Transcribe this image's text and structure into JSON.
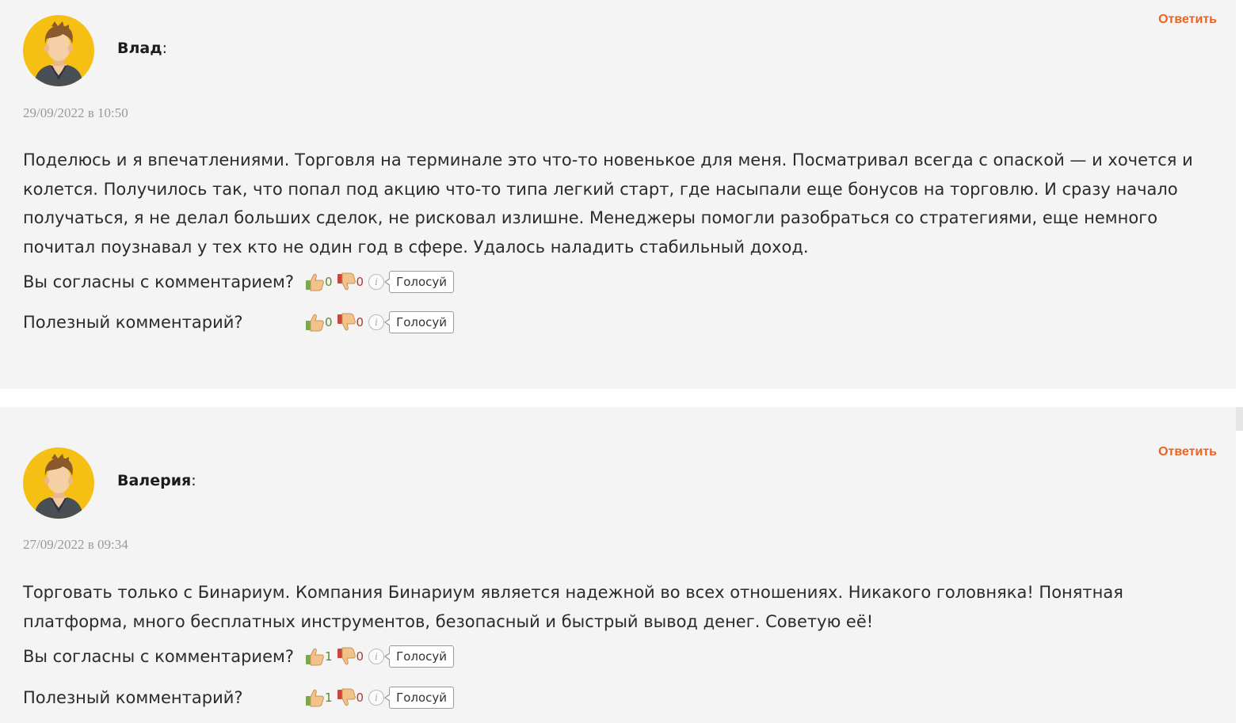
{
  "comments": [
    {
      "author": "Влад",
      "reply_label": "Ответить",
      "date": "29/09/2022 в 10:50",
      "text": "Поделюсь и я впечатлениями. Торговля на терминале это что-то новенькое для меня. Посматривал всегда с опаской — и хочется и колется. Получилось так, что попал под акцию что-то типа легкий старт, где насыпали еще бонусов на торговлю. И сразу начало получаться, я не делал больших сделок, не рисковал излишне. Менеджеры помогли разобраться со стратегиями, еще немного почитал поузнавал у тех кто не один год в сфере. Удалось наладить стабильный доход.",
      "agree": {
        "question": "Вы согласны с комментарием?",
        "up": "0",
        "down": "0",
        "button": "Голосуй"
      },
      "useful": {
        "question": "Полезный комментарий?",
        "up": "0",
        "down": "0",
        "button": "Голосуй"
      }
    },
    {
      "author": "Валерия",
      "reply_label": "Ответить",
      "date": "27/09/2022 в 09:34",
      "text": "Торговать только с Бинариум. Компания Бинариум является надежной во всех отношениях. Никакого головняка! Понятная платформа, много бесплатных инструментов, безопасный и быстрый вывод денег. Советую её!",
      "agree": {
        "question": "Вы согласны с комментарием?",
        "up": "1",
        "down": "0",
        "button": "Голосуй"
      },
      "useful": {
        "question": "Полезный комментарий?",
        "up": "1",
        "down": "0",
        "button": "Голосуй"
      }
    }
  ],
  "colors": {
    "background": "#f4f4f4",
    "reply": "#f0611e",
    "avatar_bg": "#f6bf14",
    "date": "#9a9a9a"
  },
  "icons": {
    "avatar": "user-avatar-icon",
    "thumb_up": "thumbs-up-icon",
    "thumb_down": "thumbs-down-icon",
    "info": "info-icon"
  }
}
